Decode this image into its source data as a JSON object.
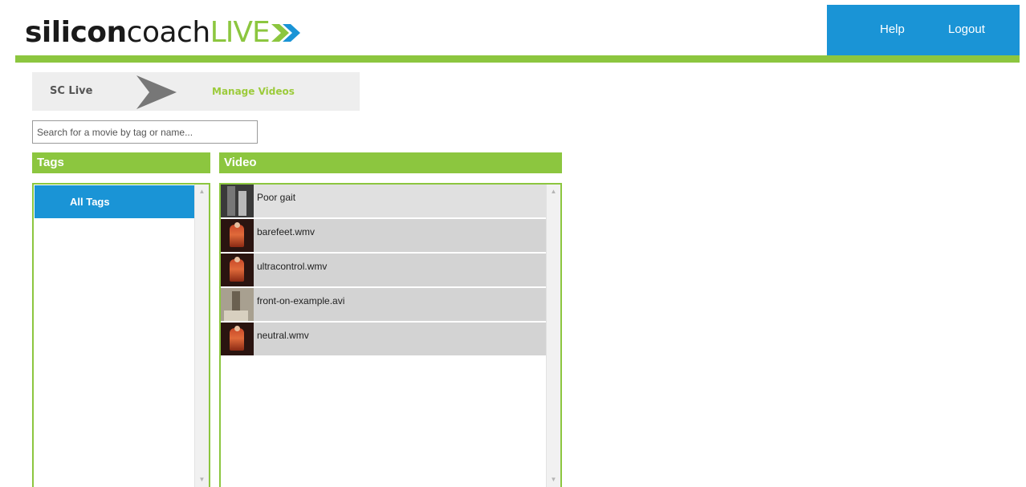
{
  "header": {
    "logo": {
      "part1": "silicon",
      "part2": "coach",
      "part3": "LIVE"
    },
    "nav": {
      "help": "Help",
      "logout": "Logout"
    }
  },
  "breadcrumb": {
    "items": [
      "SC Live",
      "Manage Videos"
    ]
  },
  "search": {
    "placeholder": "Search for a movie by tag or name...",
    "value": ""
  },
  "tags_panel": {
    "title": "Tags",
    "items": [
      {
        "label": "All Tags",
        "selected": true
      }
    ]
  },
  "video_panel": {
    "title": "Video",
    "items": [
      {
        "name": "Poor gait",
        "thumb": "dark"
      },
      {
        "name": "barefeet.wmv",
        "thumb": "red"
      },
      {
        "name": "ultracontrol.wmv",
        "thumb": "red"
      },
      {
        "name": "front-on-example.avi",
        "thumb": "light"
      },
      {
        "name": "neutral.wmv",
        "thumb": "red"
      }
    ]
  },
  "colors": {
    "accent_green": "#8cc63f",
    "accent_blue": "#1a94d6"
  },
  "icons": {
    "breadcrumb_separator": "chevron-right-icon",
    "logo_arrow": "double-chevron-right-icon",
    "scroll_up": "triangle-up-icon",
    "scroll_down": "triangle-down-icon"
  }
}
